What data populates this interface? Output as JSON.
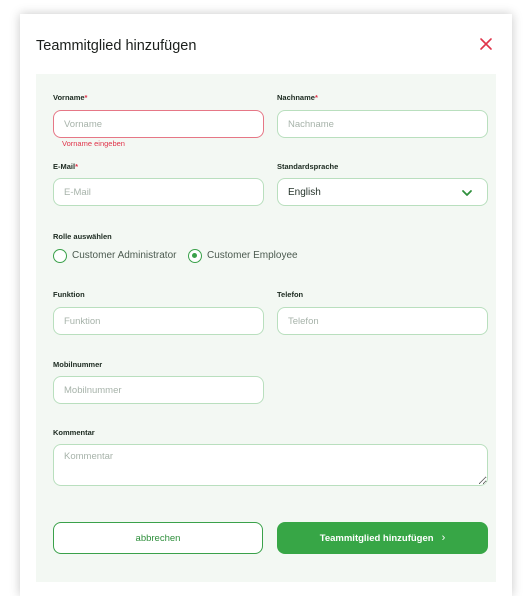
{
  "dialog": {
    "title": "Teammitglied hinzufügen"
  },
  "form": {
    "first_name": {
      "label": "Vorname",
      "required_mark": "*",
      "placeholder": "Vorname",
      "value": "",
      "error": "Vorname eingeben"
    },
    "last_name": {
      "label": "Nachname",
      "required_mark": "*",
      "placeholder": "Nachname",
      "value": ""
    },
    "email": {
      "label": "E-Mail",
      "required_mark": "*",
      "placeholder": "E-Mail",
      "value": ""
    },
    "language": {
      "label": "Standardsprache",
      "selected": "English"
    },
    "role": {
      "label": "Rolle auswählen",
      "options": [
        {
          "label": "Customer Administrator",
          "selected": false
        },
        {
          "label": "Customer Employee",
          "selected": true
        }
      ]
    },
    "function": {
      "label": "Funktion",
      "placeholder": "Funktion",
      "value": ""
    },
    "phone": {
      "label": "Telefon",
      "placeholder": "Telefon",
      "value": ""
    },
    "mobile": {
      "label": "Mobilnummer",
      "placeholder": "Mobilnummer",
      "value": ""
    },
    "comment": {
      "label": "Kommentar",
      "placeholder": "Kommentar",
      "value": ""
    }
  },
  "actions": {
    "cancel_label": "abbrechen",
    "submit_label": "Teammitglied hinzufügen",
    "submit_icon": "chevron-right-icon"
  },
  "colors": {
    "accent": "#37a646",
    "error": "#e0344a",
    "form_background": "#f3f8f3"
  }
}
